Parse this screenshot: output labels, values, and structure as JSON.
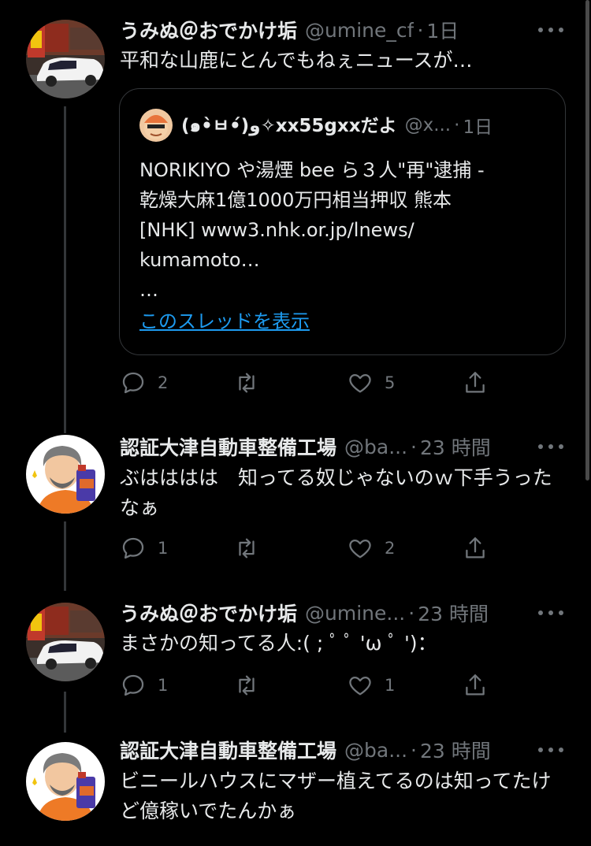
{
  "tweets": [
    {
      "name": "うみぬ＠おでかけ垢",
      "handle": "@umine_cf",
      "time": "1日",
      "text": "平和な山鹿にとんでもねぇニュースが…",
      "replies": "2",
      "likes": "5",
      "avatar": "car-avatar"
    },
    {
      "name": "認証大津自動車整備工場",
      "handle": "@ba...",
      "time": "23 時間",
      "text": "ぶはははは　知ってる奴じゃないのｗ下手うったなぁ",
      "replies": "1",
      "likes": "2",
      "avatar": "mechanic-avatar"
    },
    {
      "name": "うみぬ＠おでかけ垢",
      "handle": "@umine...",
      "time": "23 時間",
      "text": "まさかの知ってる人:( ; ﾟ ﾟ 'ω ﾟ ')：",
      "replies": "1",
      "likes": "1",
      "avatar": "car-avatar"
    },
    {
      "name": "認証大津自動車整備工場",
      "handle": "@ba...",
      "time": "23 時間",
      "text": "ビニールハウスにマザー植えてるのは知ってたけど億稼いでたんかぁ",
      "avatar": "mechanic-avatar"
    }
  ],
  "quote": {
    "name": "(๑•̀ㅂ•́)و✧xx55gxxだよ",
    "handle": "@x...",
    "time": "1日",
    "text": "NORIKIYO や湯煙 bee ら３人\"再\"逮捕 -\n乾燥大麻1億1000万円相当押収 熊本\n[NHK] www3.nhk.or.jp/lnews/\nkumamoto…\n…",
    "show_thread": "このスレッドを表示"
  },
  "separator": "·",
  "colors": {
    "background": "#000000",
    "text": "#e7e9ea",
    "muted": "#71767b",
    "link": "#1d9bf0",
    "border": "#333639"
  }
}
